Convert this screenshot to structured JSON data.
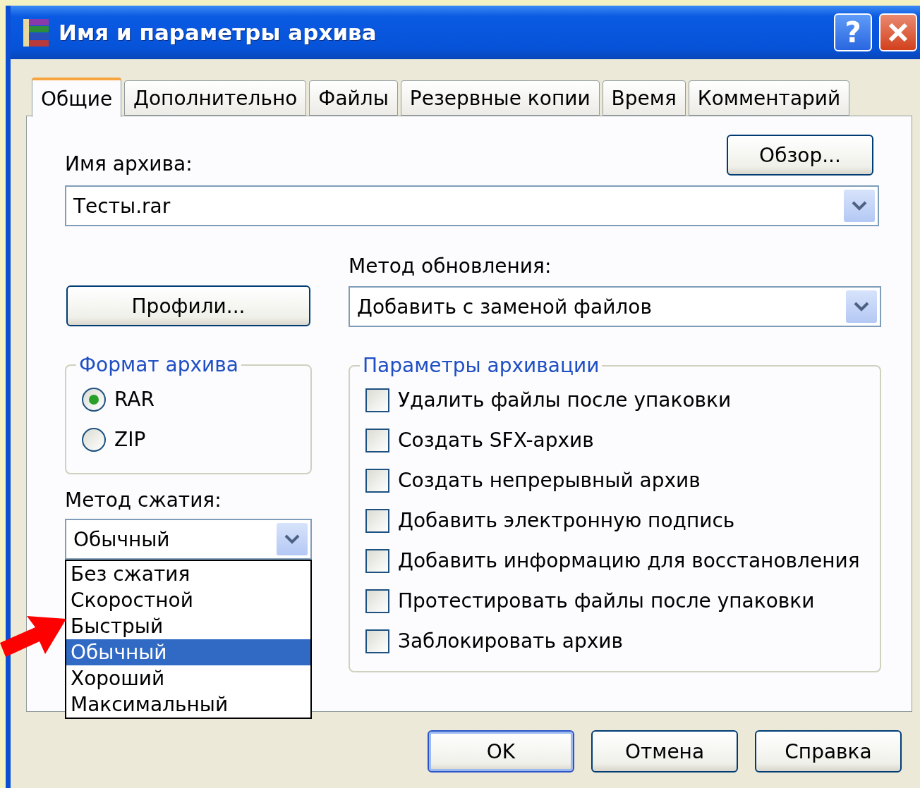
{
  "window": {
    "title": "Имя и параметры архива",
    "help_button": "?"
  },
  "tabs": [
    {
      "label": "Общие",
      "selected": true
    },
    {
      "label": "Дополнительно",
      "selected": false
    },
    {
      "label": "Файлы",
      "selected": false
    },
    {
      "label": "Резервные копии",
      "selected": false
    },
    {
      "label": "Время",
      "selected": false
    },
    {
      "label": "Комментарий",
      "selected": false
    }
  ],
  "archive_name": {
    "label": "Имя архива:",
    "value": "Тесты.rar"
  },
  "browse_button": "Обзор...",
  "profiles_button": "Профили...",
  "update_method": {
    "label": "Метод обновления:",
    "value": "Добавить с заменой файлов"
  },
  "archive_format": {
    "title": "Формат архива",
    "options": [
      {
        "label": "RAR",
        "selected": true
      },
      {
        "label": "ZIP",
        "selected": false
      }
    ]
  },
  "compression_method": {
    "label": "Метод сжатия:",
    "value": "Обычный",
    "dropdown": [
      {
        "label": "Без сжатия",
        "selected": false
      },
      {
        "label": "Скоростной",
        "selected": false
      },
      {
        "label": "Быстрый",
        "selected": false
      },
      {
        "label": "Обычный",
        "selected": true
      },
      {
        "label": "Хороший",
        "selected": false
      },
      {
        "label": "Максимальный",
        "selected": false
      }
    ]
  },
  "archive_options": {
    "title": "Параметры архивации",
    "options": [
      {
        "label": "Удалить файлы после упаковки",
        "checked": false
      },
      {
        "label": "Создать SFX-архив",
        "checked": false
      },
      {
        "label": "Создать непрерывный архив",
        "checked": false
      },
      {
        "label": "Добавить электронную подпись",
        "checked": false
      },
      {
        "label": "Добавить информацию для восстановления",
        "checked": false
      },
      {
        "label": "Протестировать файлы после упаковки",
        "checked": false
      },
      {
        "label": "Заблокировать архив",
        "checked": false
      }
    ]
  },
  "buttons": [
    {
      "label": "OK",
      "default": true
    },
    {
      "label": "Отмена",
      "default": false
    },
    {
      "label": "Справка",
      "default": false
    }
  ]
}
